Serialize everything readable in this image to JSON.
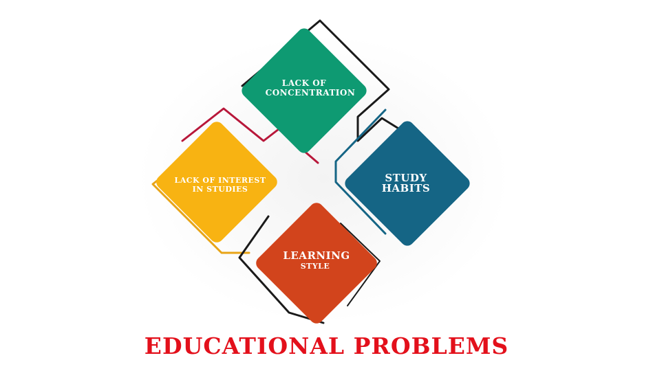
{
  "title": "EDUCATIONAL PROBLEMS",
  "colors": {
    "title": "#e3101b",
    "concentration": "#0e9a72",
    "study_habits": "#156585",
    "interest": "#f8b312",
    "learning_style": "#d2441c",
    "frame_dark": "#1a1a1a",
    "frame_red": "#b8173a"
  },
  "tiles": {
    "concentration": {
      "line1": "LACK OF",
      "line2": "CONCENTRATION"
    },
    "study_habits": {
      "line1": "STUDY",
      "line2": "HABITS"
    },
    "interest": {
      "line1": "LACK OF INTEREST",
      "line2": "IN STUDIES"
    },
    "learning_style": {
      "line1": "LEARNING",
      "line2": "STYLE"
    }
  }
}
